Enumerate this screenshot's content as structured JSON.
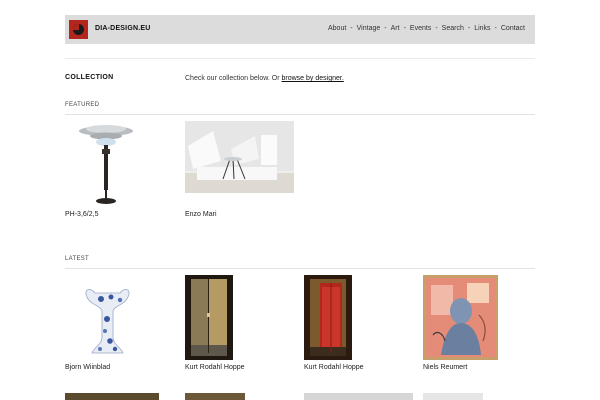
{
  "header": {
    "logo_text": "DIA-DESIGN.EU",
    "nav": [
      {
        "label": "About"
      },
      {
        "label": "Vintage"
      },
      {
        "label": "Art"
      },
      {
        "label": "Events"
      },
      {
        "label": "Search"
      },
      {
        "label": "Links"
      },
      {
        "label": "Contact"
      }
    ],
    "separator": "-"
  },
  "collection": {
    "title": "COLLECTION",
    "intro_prefix": "Check our collection below. Or ",
    "intro_link": "browse by designer."
  },
  "featured": {
    "label": "FEATURED",
    "items": [
      {
        "caption": "PH-3,6/2,5",
        "image": "lamp-image"
      },
      {
        "caption": "Enzo Mari",
        "image": "room-image"
      }
    ]
  },
  "latest": {
    "label": "LATEST",
    "items": [
      {
        "caption": "Bjorn Wiinblad",
        "image": "vase-image"
      },
      {
        "caption": "Kurt Rodahl Hoppe",
        "image": "painting-image"
      },
      {
        "caption": "Kurt Rodahl Hoppe",
        "image": "painting-image"
      },
      {
        "caption": "Niels Reumert",
        "image": "painting-image"
      }
    ]
  },
  "colors": {
    "header_bg": "#dcdcdc",
    "logo_red": "#b3261e",
    "rule": "#e2e2e2"
  }
}
